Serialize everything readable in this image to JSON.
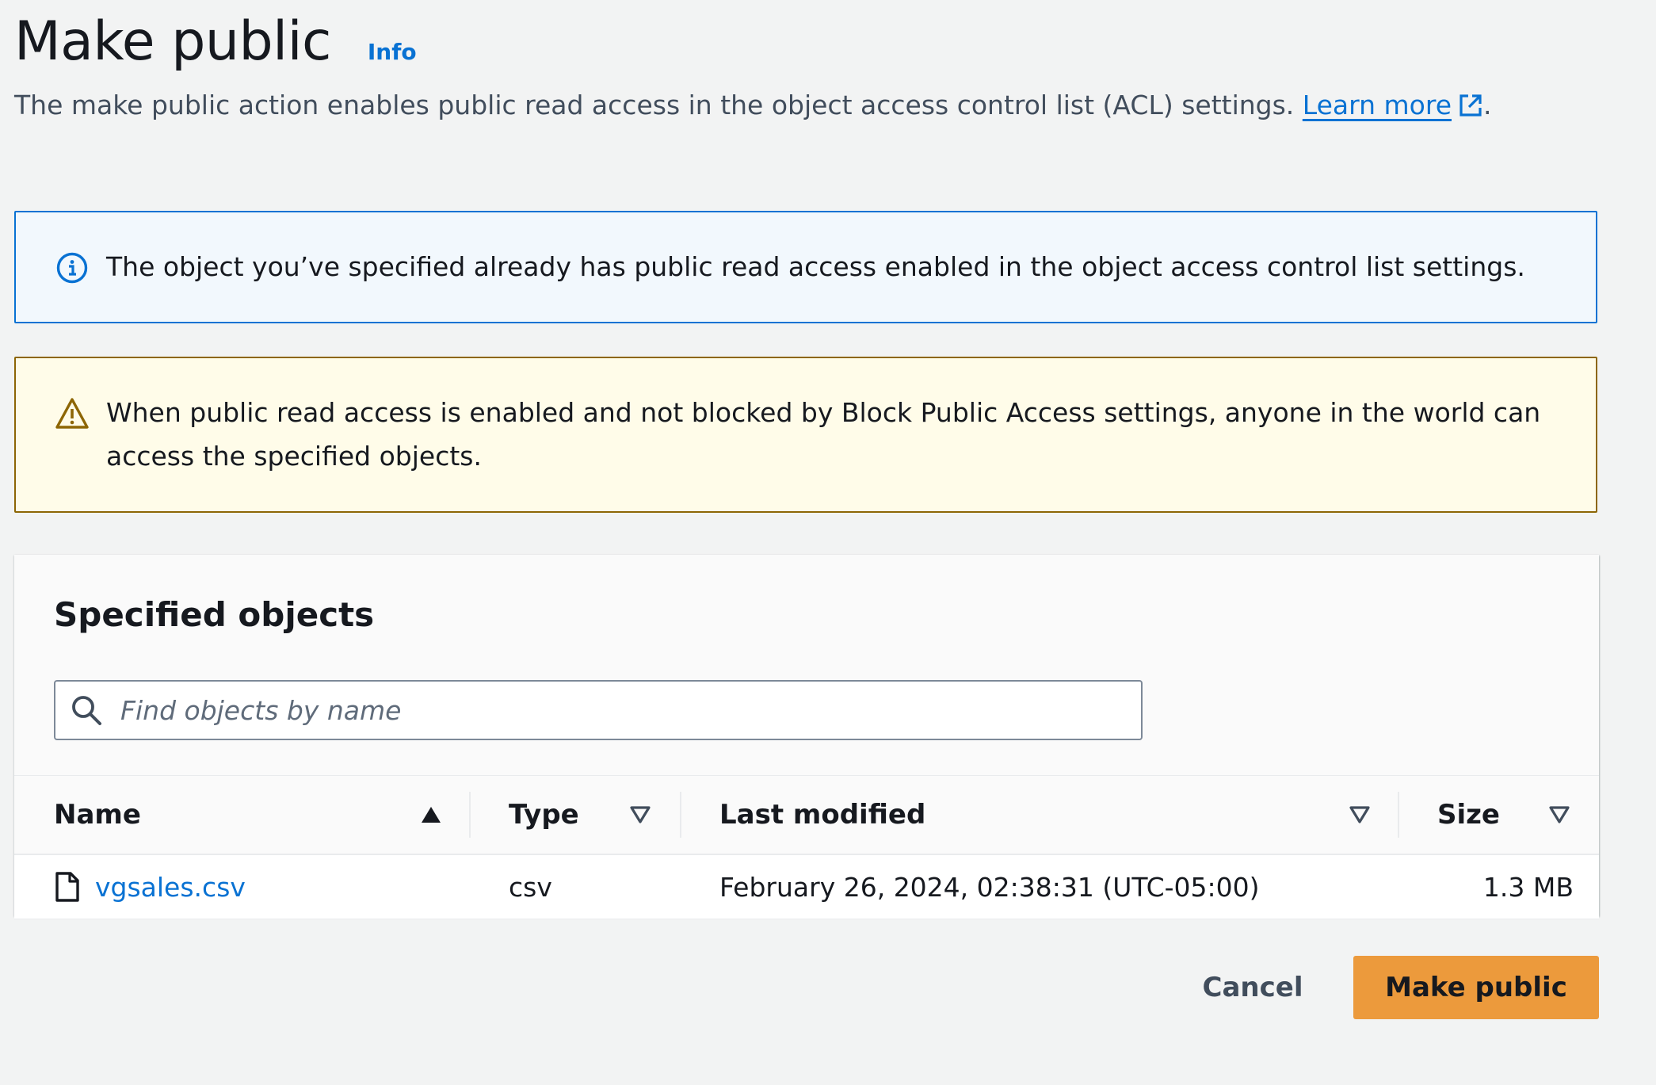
{
  "header": {
    "title": "Make public",
    "info_link": "Info",
    "description": "The make public action enables public read access in the object access control list (ACL) settings.",
    "learn_more": "Learn more",
    "trailing_punct": "."
  },
  "alerts": {
    "info": {
      "icon": "info-circle-icon",
      "text": "The object you’ve specified already has public read access enabled in the object access control list settings."
    },
    "warning": {
      "icon": "warning-triangle-icon",
      "text": "When public read access is enabled and not blocked by Block Public Access settings, anyone in the world can access the specified objects."
    }
  },
  "objects_panel": {
    "title": "Specified objects",
    "search": {
      "placeholder": "Find objects by name",
      "value": ""
    },
    "columns": [
      {
        "label": "Name",
        "sort": "ascending"
      },
      {
        "label": "Type",
        "sort": "none"
      },
      {
        "label": "Last modified",
        "sort": "none"
      },
      {
        "label": "Size",
        "sort": "none"
      }
    ],
    "rows": [
      {
        "name": "vgsales.csv",
        "type": "csv",
        "last_modified": "February 26, 2024, 02:38:31 (UTC-05:00)",
        "size": "1.3 MB"
      }
    ]
  },
  "actions": {
    "cancel": "Cancel",
    "primary": "Make public"
  },
  "colors": {
    "link": "#0972d3",
    "info_border": "#0972d3",
    "info_bg": "#f2f8fd",
    "warning_border": "#8d6605",
    "warning_bg": "#fffce9",
    "primary_button": "#ec9a3c",
    "page_bg": "#f2f3f3"
  }
}
